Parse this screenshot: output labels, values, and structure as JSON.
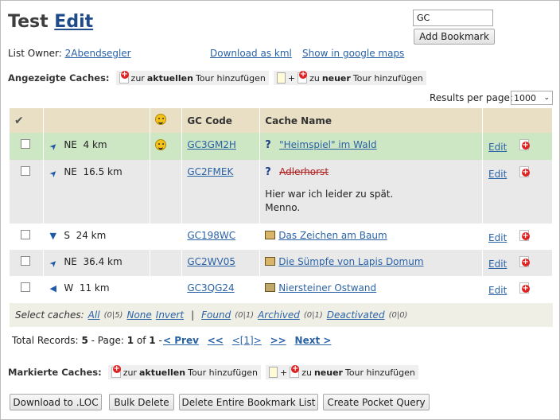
{
  "page": {
    "title_prefix": "Test",
    "title_link": "Edit"
  },
  "search": {
    "value": "GC"
  },
  "add_bookmark_label": "Add Bookmark",
  "owner": {
    "label": "List Owner:",
    "name": "2Abendsegler"
  },
  "links": {
    "download_kml": "Download as kml",
    "google_maps": "Show in google maps"
  },
  "displayed": {
    "label": "Angezeigte Caches:",
    "add_current_pre": "zur",
    "add_current_bold": "aktuellen",
    "add_current_post": "Tour hinzufügen",
    "plus": "+",
    "add_new_pre": "zu",
    "add_new_bold": "neuer",
    "add_new_post": "Tour hinzufügen"
  },
  "results_per_page": {
    "label": "Results per page:",
    "value": "1000"
  },
  "table": {
    "headers": [
      "GC Code",
      "Cache Name"
    ],
    "rows": [
      {
        "dir": "NE",
        "dist": "4 km",
        "arrow": "➤",
        "smiley": true,
        "code": "GC3GM2H",
        "type": "mystery",
        "name": "\"Heimspiel\" im Wald",
        "archived": false,
        "note": "",
        "edit": "Edit"
      },
      {
        "dir": "NE",
        "dist": "16.5 km",
        "arrow": "➤",
        "smiley": false,
        "code": "GC2FMEK",
        "type": "mystery",
        "name": "Adlerhorst",
        "archived": true,
        "note_line1": "Hier war ich leider zu spät.",
        "note_line2": "Menno.",
        "edit": "Edit"
      },
      {
        "dir": "S",
        "dist": "24 km",
        "arrow": "▼",
        "smiley": false,
        "code": "GC198WC",
        "type": "multi",
        "name": "Das Zeichen am Baum",
        "archived": false,
        "edit": "Edit"
      },
      {
        "dir": "NE",
        "dist": "36.4 km",
        "arrow": "➤",
        "smiley": false,
        "code": "GC2WV05",
        "type": "multi",
        "name": "Die Sümpfe von Lapis Domum",
        "archived": false,
        "edit": "Edit"
      },
      {
        "dir": "W",
        "dist": "11 km",
        "arrow": "◀",
        "smiley": false,
        "code": "GC3QG24",
        "type": "traditional",
        "name": "Niersteiner Ostwand",
        "archived": false,
        "edit": "Edit"
      }
    ]
  },
  "select_caches": {
    "label": "Select caches:",
    "all": "All",
    "all_count": "(0|5)",
    "none": "None",
    "invert": "Invert",
    "sep": "|",
    "found": "Found",
    "found_count": "(0|1)",
    "archived": "Archived",
    "archived_count": "(0|1)",
    "deactivated": "Deactivated",
    "deactivated_count": "(0|0)"
  },
  "records": {
    "prefix": "Total Records:",
    "count": "5",
    "page_text": "- Page:",
    "page": "1",
    "of": "of",
    "total_pages": "1",
    "dash": "-"
  },
  "pager": {
    "prev": "< Prev",
    "first": "<<",
    "current": "<[1]>",
    "last": ">>",
    "next": "Next >"
  },
  "marked": {
    "label": "Markierte Caches:",
    "add_current_pre": "zur",
    "add_current_bold": "aktuellen",
    "add_current_post": "Tour hinzufügen",
    "plus": "+",
    "add_new_pre": "zu",
    "add_new_bold": "neuer",
    "add_new_post": "Tour hinzufügen"
  },
  "buttons": {
    "download_loc": "Download to .LOC",
    "bulk_delete": "Bulk Delete",
    "delete_list": "Delete Entire Bookmark List",
    "pocket_query": "Create Pocket Query"
  }
}
